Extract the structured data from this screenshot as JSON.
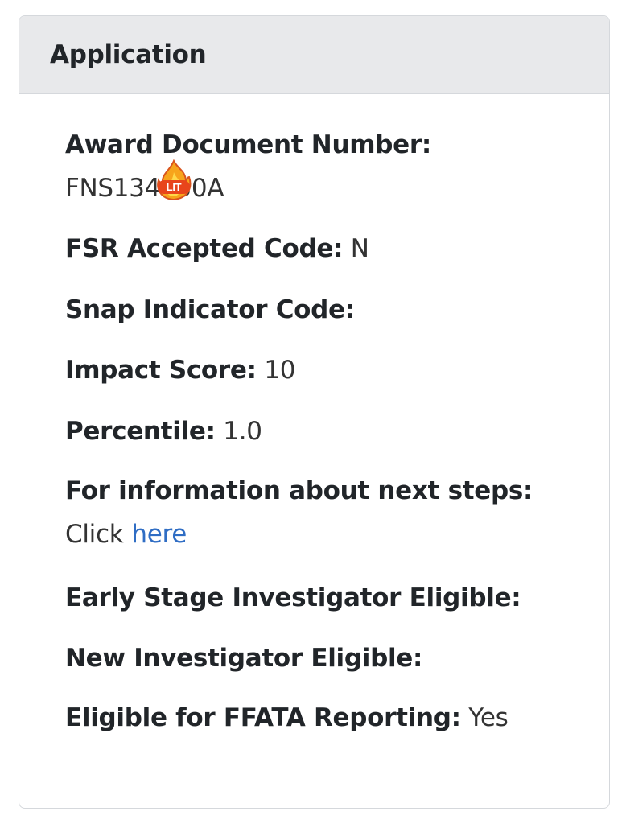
{
  "panel": {
    "title": "Application"
  },
  "fields": {
    "award_doc": {
      "label": "Award Document Number:",
      "value": "FNS134130A"
    },
    "fsr_code": {
      "label": "FSR Accepted Code:",
      "value": "N"
    },
    "snap_code": {
      "label": "Snap Indicator Code:",
      "value": ""
    },
    "impact_score": {
      "label": "Impact Score:",
      "value": "10"
    },
    "percentile": {
      "label": "Percentile:",
      "value": "1.0"
    },
    "next_steps": {
      "label": "For information about next steps:",
      "prefix": "Click",
      "link_text": "here"
    },
    "esi_eligible": {
      "label": "Early Stage Investigator Eligible:",
      "value": ""
    },
    "ni_eligible": {
      "label": "New Investigator Eligible:",
      "value": ""
    },
    "ffata": {
      "label": "Eligible for FFATA Reporting:",
      "value": "Yes"
    }
  },
  "sticker": {
    "icon": "lit-fire-emoji-icon",
    "text": "LIT"
  },
  "colors": {
    "header_bg": "#e8e9eb",
    "border": "#d5d8dc",
    "link": "#2f6dc4",
    "text": "#212529"
  }
}
